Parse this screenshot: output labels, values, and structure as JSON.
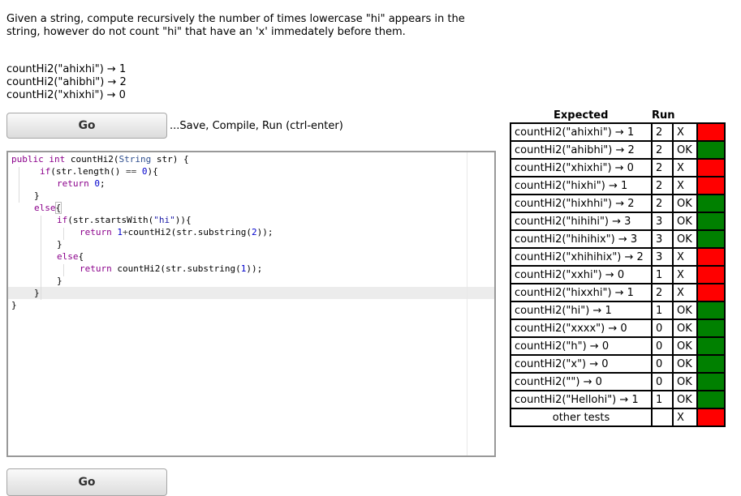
{
  "prompt": "Given a string, compute recursively the number of times lowercase \"hi\" appears in the string, however do not count \"hi\" that have an 'x' immedately before them.",
  "examples": [
    "countHi2(\"ahixhi\") → 1",
    "countHi2(\"ahibhi\") → 2",
    "countHi2(\"xhixhi\") → 0"
  ],
  "go_label": "Go",
  "hint": "...Save, Compile, Run (ctrl-enter)",
  "results": {
    "header_expected": "Expected",
    "header_run": "Run",
    "rows": [
      {
        "expected": "countHi2(\"ahixhi\") → 1",
        "run": "2",
        "result": "X",
        "status": "fail"
      },
      {
        "expected": "countHi2(\"ahibhi\") → 2",
        "run": "2",
        "result": "OK",
        "status": "pass"
      },
      {
        "expected": "countHi2(\"xhixhi\") → 0",
        "run": "2",
        "result": "X",
        "status": "fail"
      },
      {
        "expected": "countHi2(\"hixhi\") → 1",
        "run": "2",
        "result": "X",
        "status": "fail"
      },
      {
        "expected": "countHi2(\"hixhhi\") → 2",
        "run": "2",
        "result": "OK",
        "status": "pass"
      },
      {
        "expected": "countHi2(\"hihihi\") → 3",
        "run": "3",
        "result": "OK",
        "status": "pass"
      },
      {
        "expected": "countHi2(\"hihihix\") → 3",
        "run": "3",
        "result": "OK",
        "status": "pass"
      },
      {
        "expected": "countHi2(\"xhihihix\") → 2",
        "run": "3",
        "result": "X",
        "status": "fail"
      },
      {
        "expected": "countHi2(\"xxhi\") → 0",
        "run": "1",
        "result": "X",
        "status": "fail"
      },
      {
        "expected": "countHi2(\"hixxhi\") → 1",
        "run": "2",
        "result": "X",
        "status": "fail"
      },
      {
        "expected": "countHi2(\"hi\") → 1",
        "run": "1",
        "result": "OK",
        "status": "pass"
      },
      {
        "expected": "countHi2(\"xxxx\") → 0",
        "run": "0",
        "result": "OK",
        "status": "pass"
      },
      {
        "expected": "countHi2(\"h\") → 0",
        "run": "0",
        "result": "OK",
        "status": "pass"
      },
      {
        "expected": "countHi2(\"x\") → 0",
        "run": "0",
        "result": "OK",
        "status": "pass"
      },
      {
        "expected": "countHi2(\"\") → 0",
        "run": "0",
        "result": "OK",
        "status": "pass"
      },
      {
        "expected": "countHi2(\"Hellohi\") → 1",
        "run": "1",
        "result": "OK",
        "status": "pass"
      },
      {
        "expected": "other tests",
        "run": "",
        "result": "X",
        "status": "fail"
      }
    ]
  },
  "code": {
    "l1": {
      "a": "public",
      "b": " ",
      "c": "int",
      "d": " countHi2(",
      "e": "String",
      "f": " str) {"
    },
    "l2": {
      "a": "if",
      "b": "(str.length() ",
      "c": "==",
      "d": " ",
      "e": "0",
      "f": "){"
    },
    "l3": {
      "a": "return",
      "b": " ",
      "c": "0",
      "d": ";"
    },
    "l4": "}",
    "l5": {
      "a": "else",
      "b": "{"
    },
    "l6": {
      "a": "if",
      "b": "(str.startsWith(",
      "c": "\"hi\"",
      "d": ")){"
    },
    "l7": {
      "a": "return",
      "b": " ",
      "c": "1",
      "d": "+",
      "e": "countHi2(str.substring(",
      "f": "2",
      "g": "));"
    },
    "l8": "}",
    "l9": {
      "a": "else",
      "b": "{"
    },
    "l10": {
      "a": "return",
      "b": " countHi2(str.substring(",
      "c": "1",
      "d": "));"
    },
    "l11": "}",
    "l12": "}",
    "l13": "}"
  },
  "colors": {
    "pass": "#008000",
    "fail": "#ff0000"
  }
}
